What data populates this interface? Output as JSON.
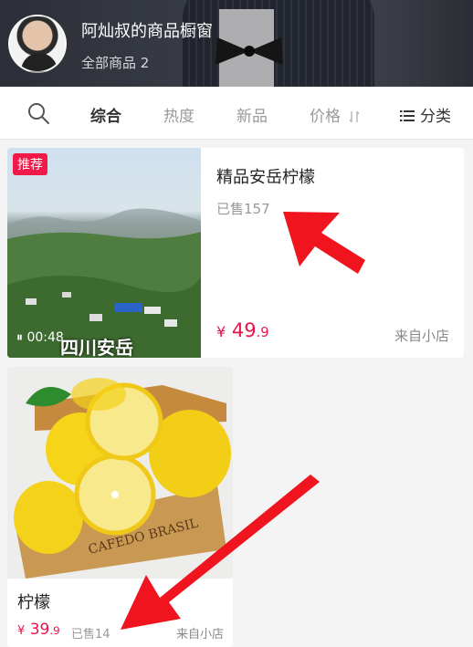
{
  "header": {
    "store_title": "阿灿叔的商品橱窗",
    "subtitle": "全部商品 2"
  },
  "filters": {
    "comprehensive": "综合",
    "popularity": "热度",
    "new": "新品",
    "price": "价格",
    "category": "分类"
  },
  "products": [
    {
      "badge": "推荐",
      "video_time": "00:48",
      "image_text": "四川安岳",
      "name": "精品安岳柠檬",
      "sold": "已售157",
      "price_symbol": "¥",
      "price_int": "49",
      "price_dec": ".9",
      "source": "来自小店"
    },
    {
      "name": "柠檬",
      "sold": "已售14",
      "price_symbol": "¥",
      "price_int": "39",
      "price_dec": ".9",
      "source": "来自小店"
    }
  ],
  "colors": {
    "price": "#e8154a",
    "badge": "#f0194a",
    "arrow": "#f0141e"
  }
}
